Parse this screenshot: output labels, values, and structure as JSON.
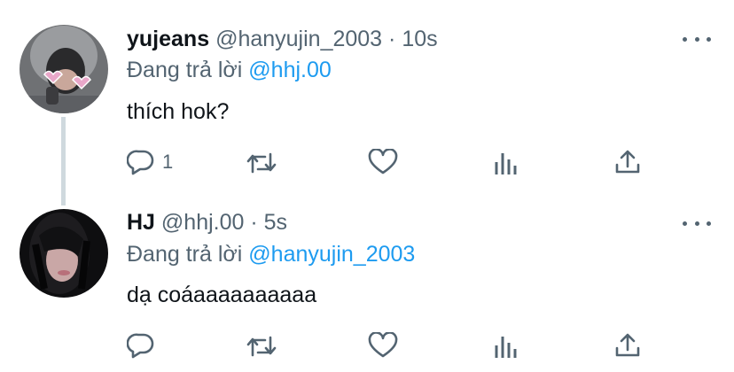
{
  "tweets": [
    {
      "name": "yujeans",
      "handle": "@hanyujin_2003",
      "separator": "·",
      "time": "10s",
      "replying_prefix": "Đang trả lời",
      "replying_to": "@hhj.00",
      "text": "thích hok?",
      "reply_count": "1",
      "more_icon": "more-horizontal-icon"
    },
    {
      "name": "HJ",
      "handle": "@hhj.00",
      "separator": "·",
      "time": "5s",
      "replying_prefix": "Đang trả lời",
      "replying_to": "@hanyujin_2003",
      "text": "dạ coáaaaaaaaaaa",
      "reply_count": "",
      "more_icon": "more-horizontal-icon"
    }
  ],
  "colors": {
    "accent": "#1d9bf0",
    "muted": "#536471",
    "text": "#0f1419",
    "thread_line": "#cfd9de"
  },
  "icons": [
    "reply-icon",
    "retweet-icon",
    "like-icon",
    "analytics-icon",
    "share-icon"
  ]
}
